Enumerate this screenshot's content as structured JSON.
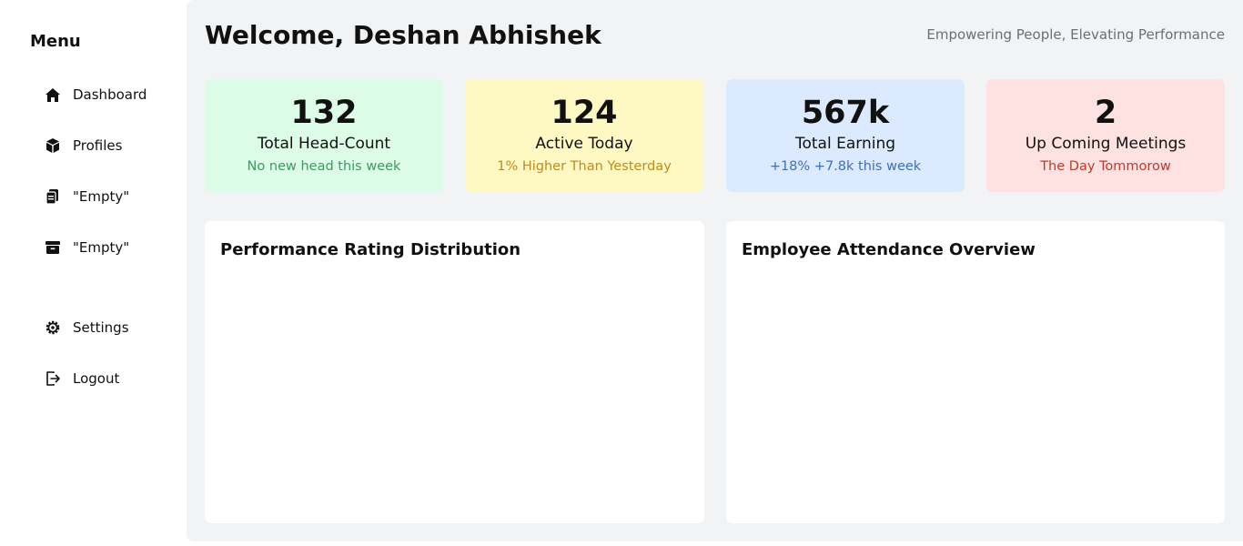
{
  "sidebar": {
    "title": "Menu",
    "items": [
      {
        "label": "Dashboard",
        "icon": "home-icon"
      },
      {
        "label": "Profiles",
        "icon": "cube-icon"
      },
      {
        "label": "\"Empty\"",
        "icon": "clipboard-icon"
      },
      {
        "label": "\"Empty\"",
        "icon": "archive-icon"
      },
      {
        "label": "Settings",
        "icon": "gear-icon"
      },
      {
        "label": "Logout",
        "icon": "logout-icon"
      }
    ]
  },
  "header": {
    "welcome": "Welcome, Deshan Abhishek",
    "tagline": "Empowering People, Elevating Performance"
  },
  "stats": [
    {
      "value": "132",
      "label": "Total Head-Count",
      "sub": "No new head this week",
      "bg": "#dcfce7",
      "sub_color": "#3e9a5e"
    },
    {
      "value": "124",
      "label": "Active Today",
      "sub": "1% Higher Than Yesterday",
      "bg": "#fef9c3",
      "sub_color": "#c18a1e"
    },
    {
      "value": "567k",
      "label": "Total Earning",
      "sub": "+18% +7.8k this week",
      "bg": "#dbeafe",
      "sub_color": "#3f6fbf"
    },
    {
      "value": "2",
      "label": "Up Coming Meetings",
      "sub": "The Day Tommorow",
      "bg": "#fee2e2",
      "sub_color": "#c0392b"
    }
  ],
  "panels": {
    "performance_title": "Performance Rating Distribution",
    "attendance_title": "Employee Attendance Overview"
  },
  "colors": {
    "main_bg": "#f2f3f5",
    "panel_bg": "#ffffff",
    "text": "#111111",
    "muted": "#6b6f76"
  }
}
